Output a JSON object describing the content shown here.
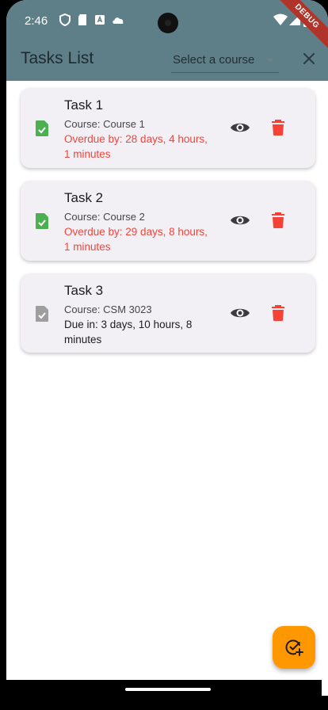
{
  "status_bar": {
    "time": "2:46",
    "icons": [
      "shield-icon",
      "sd-card-icon",
      "a-badge-icon",
      "cloud-icon",
      "wifi-icon",
      "signal-icon",
      "battery-icon"
    ],
    "debug_banner": "DEBUG"
  },
  "app_bar": {
    "title": "Tasks List",
    "course_select": {
      "selected": "Select a course"
    },
    "close_icon": "close-icon",
    "background_color": "#5f7f88"
  },
  "tasks": [
    {
      "title": "Task 1",
      "course": "Course: Course 1",
      "due_text": "Overdue by: 28 days, 4 hours, 1 minutes",
      "status": "overdue",
      "completed": true
    },
    {
      "title": "Task 2",
      "course": "Course: Course 2",
      "due_text": "Overdue by: 29 days, 8 hours, 1 minutes",
      "status": "overdue",
      "completed": true
    },
    {
      "title": "Task 3",
      "course": "Course: CSM 3023",
      "due_text": "Due in: 3 days, 10 hours, 8 minutes",
      "status": "upcoming",
      "completed": false
    }
  ],
  "colors": {
    "accent_fab": "#ff9800",
    "overdue_text": "#f0463c",
    "delete_icon": "#f44336",
    "completed_icon": "#4caf50",
    "pending_icon": "#9e9e9e"
  },
  "fab": {
    "icon": "add-task-icon"
  }
}
